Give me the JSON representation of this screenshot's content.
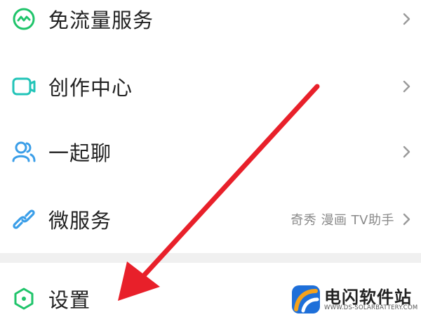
{
  "menu": {
    "items": [
      {
        "label": "免流量服务",
        "icon": "traffic-wave-icon",
        "sub": ""
      },
      {
        "label": "创作中心",
        "icon": "creator-video-icon",
        "sub": ""
      },
      {
        "label": "一起聊",
        "icon": "people-chat-icon",
        "sub": ""
      },
      {
        "label": "微服务",
        "icon": "link-chain-icon",
        "sub": "奇秀 漫画 TV助手"
      }
    ],
    "settings": {
      "label": "设置",
      "icon": "hexagon-settings-icon"
    }
  },
  "watermark": {
    "name": "电闪软件站",
    "url": "WWW.DS-SOLARBATTERY.COM"
  },
  "colors": {
    "icon_green": "#1fc46a",
    "icon_teal": "#22c4b8",
    "icon_blue": "#3a9ee8",
    "arrow_red": "#e8202a",
    "text": "#222222",
    "sub_text": "#8a8a8a",
    "divider": "#f0f0f0"
  }
}
